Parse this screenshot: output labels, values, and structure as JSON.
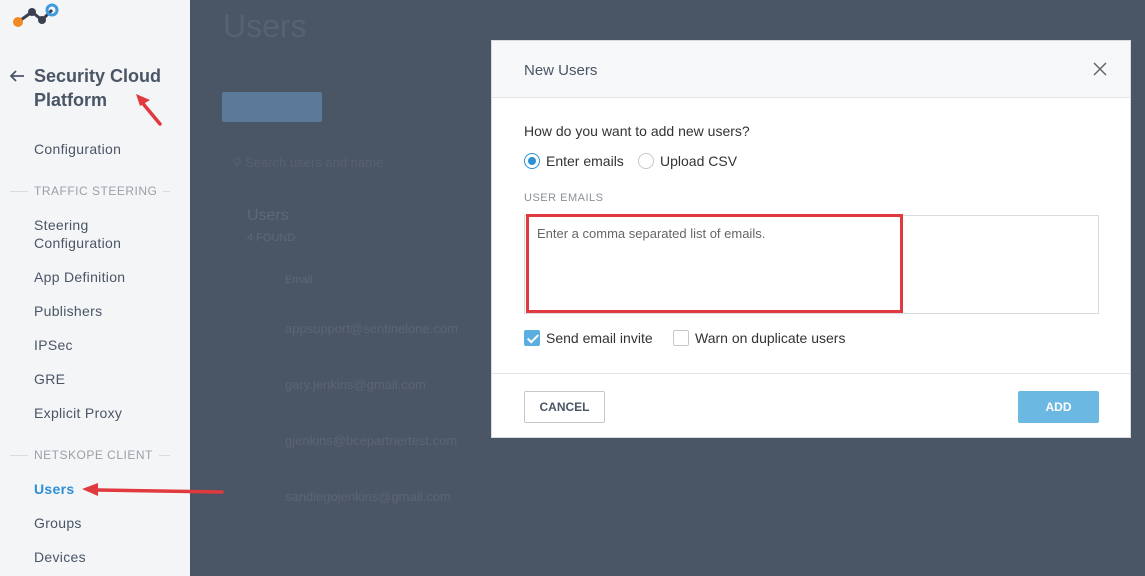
{
  "sidebar": {
    "logo_icon": "netskope-logo-icon",
    "back_icon": "arrow-left-icon",
    "title": "Security Cloud Platform",
    "config_label": "Configuration",
    "sections": [
      {
        "heading": "TRAFFIC STEERING",
        "items": [
          "Steering Configuration",
          "App Definition",
          "Publishers",
          "IPSec",
          "GRE",
          "Explicit Proxy"
        ]
      },
      {
        "heading": "NETSKOPE CLIENT",
        "items": [
          "Users",
          "Groups",
          "Devices"
        ]
      }
    ],
    "active_item": "Users"
  },
  "background": {
    "page_title": "Users",
    "search_placeholder": "Search users and name",
    "list_title": "Users",
    "list_subtitle": "4 FOUND",
    "column_email": "Email",
    "rows": [
      "appsupport@sentinelone.com",
      "gary.jenkins@gmail.com",
      "gjenkins@bcepartnertest.com",
      "sandiegojenkins@gmail.com"
    ]
  },
  "modal": {
    "title": "New Users",
    "close_icon": "close-icon",
    "question": "How do you want to add new users?",
    "radio_options": [
      {
        "label": "Enter emails",
        "selected": true
      },
      {
        "label": "Upload CSV",
        "selected": false
      }
    ],
    "emails_label": "USER EMAILS",
    "emails_placeholder": "Enter a comma separated list of emails.",
    "emails_value": "",
    "checkboxes": [
      {
        "label": "Send email invite",
        "checked": true
      },
      {
        "label": "Warn on duplicate users",
        "checked": false
      }
    ],
    "cancel_label": "CANCEL",
    "add_label": "ADD"
  },
  "colors": {
    "accent": "#2d8fd5",
    "add_button": "#6bb8e2",
    "annotation": "#e0393e",
    "overlay": "#4a5566"
  }
}
